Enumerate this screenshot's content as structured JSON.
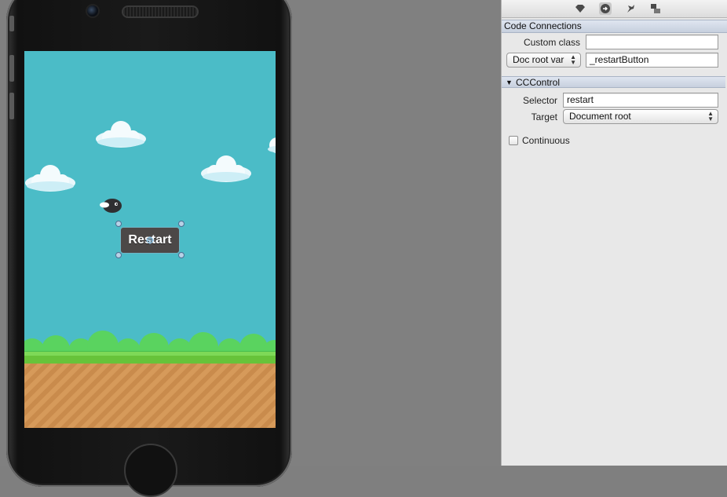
{
  "game": {
    "restart_label": "Restart"
  },
  "inspector": {
    "toolbar_icons": [
      "node-properties-icon",
      "code-connections-icon",
      "pin-icon",
      "layout-icon"
    ],
    "code_connections": {
      "header": "Code Connections",
      "custom_class_label": "Custom class",
      "custom_class_value": "",
      "assignment_popup": "Doc root var",
      "variable_value": "_restartButton"
    },
    "cccontrol": {
      "header": "CCControl",
      "selector_label": "Selector",
      "selector_value": "restart",
      "target_label": "Target",
      "target_value": "Document root",
      "continuous_label": "Continuous",
      "continuous_checked": false
    }
  },
  "colors": {
    "sky": "#4bbcc7",
    "grass": "#67c33a",
    "ground": "#d69a5a",
    "selection": "#6fb5c6"
  }
}
